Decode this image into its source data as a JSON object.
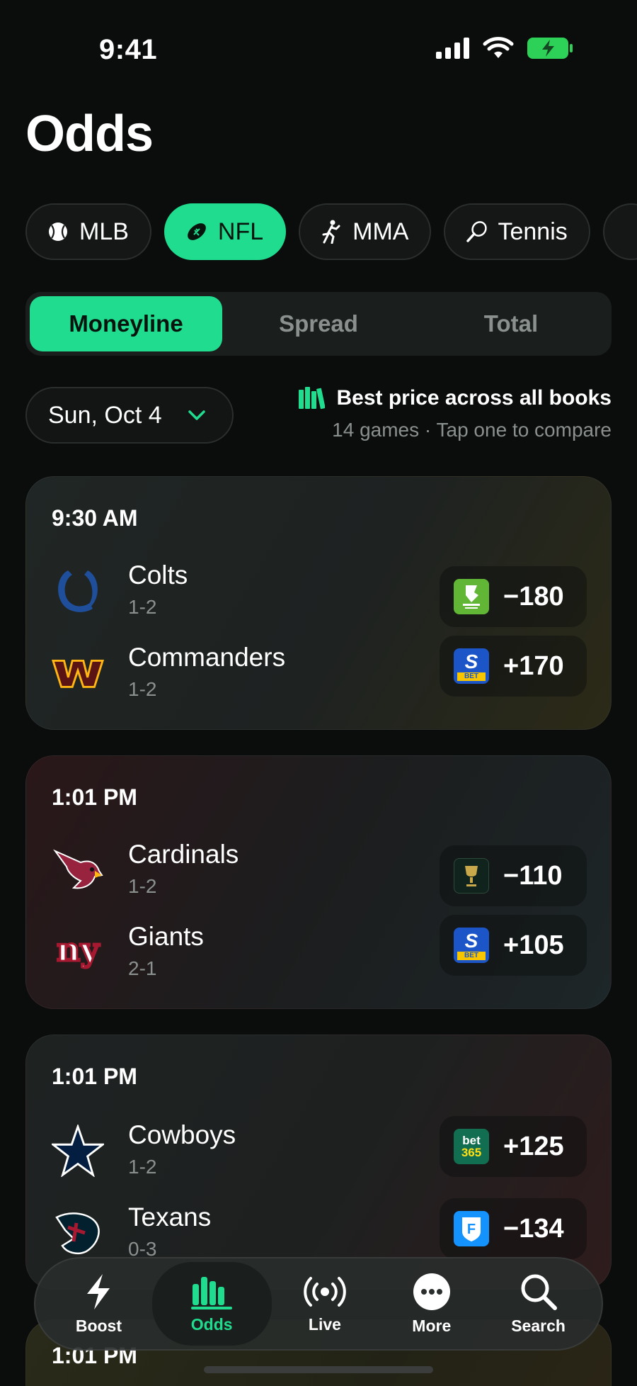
{
  "status": {
    "time": "9:41"
  },
  "page": {
    "title": "Odds"
  },
  "sports": [
    {
      "label": "MLB",
      "icon": "baseball-icon",
      "active": false
    },
    {
      "label": "NFL",
      "icon": "football-icon",
      "active": true
    },
    {
      "label": "MMA",
      "icon": "fighter-icon",
      "active": false
    },
    {
      "label": "Tennis",
      "icon": "tennis-racket-icon",
      "active": false
    }
  ],
  "markets": {
    "moneyline": "Moneyline",
    "spread": "Spread",
    "total": "Total",
    "active": "Moneyline"
  },
  "date_filter": {
    "label": "Sun, Oct 4",
    "icon": "chevron-down-icon"
  },
  "info": {
    "title": "Best price across all books",
    "subtitle": "14 games · Tap one to compare",
    "icon": "books-icon"
  },
  "games": [
    {
      "time": "9:30 AM",
      "teams": [
        {
          "name": "Colts",
          "record": "1-2",
          "odds": "−180",
          "book": "DraftKings"
        },
        {
          "name": "Commanders",
          "record": "1-2",
          "odds": "+170",
          "book": "Sportsbet"
        }
      ]
    },
    {
      "time": "1:01 PM",
      "teams": [
        {
          "name": "Cardinals",
          "record": "1-2",
          "odds": "−110",
          "book": "Caesars"
        },
        {
          "name": "Giants",
          "record": "2-1",
          "odds": "+105",
          "book": "Sportsbet"
        }
      ]
    },
    {
      "time": "1:01 PM",
      "teams": [
        {
          "name": "Cowboys",
          "record": "1-2",
          "odds": "+125",
          "book": "bet365"
        },
        {
          "name": "Texans",
          "record": "0-3",
          "odds": "−134",
          "book": "FanDuel"
        }
      ]
    },
    {
      "time": "1:01 PM"
    }
  ],
  "books": {
    "bet365_line1": "bet",
    "bet365_line2": "365",
    "sportsbet_s": "S",
    "sportsbet_bet": "BET",
    "fanduel": "F"
  },
  "tabbar": {
    "boost": "Boost",
    "odds": "Odds",
    "live": "Live",
    "more": "More",
    "search": "Search",
    "active": "Odds"
  },
  "colors": {
    "accent": "#1fdc8e",
    "background": "#0b0c0c"
  }
}
